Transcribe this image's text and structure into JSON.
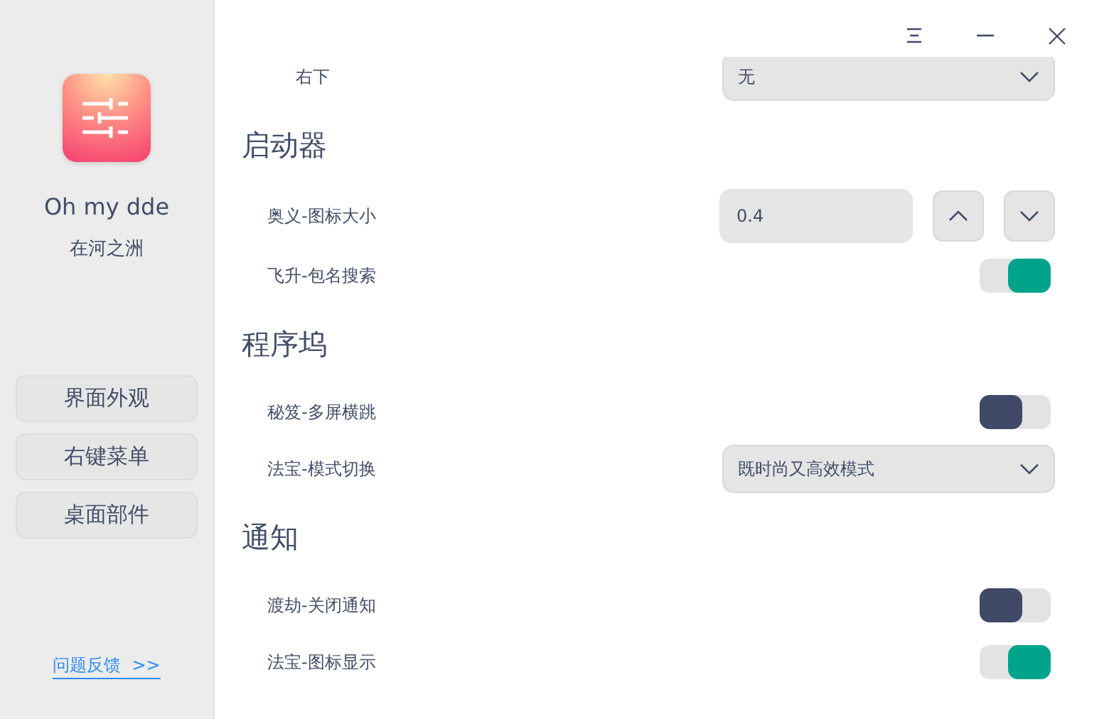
{
  "sidebar": {
    "app_name": "Oh my dde",
    "subtitle": "在河之洲",
    "items": [
      {
        "label": "界面外观"
      },
      {
        "label": "右键菜单"
      },
      {
        "label": "桌面部件"
      }
    ],
    "feedback_link": "问题反馈  >>"
  },
  "sections": [
    {
      "rows": [
        {
          "kind": "select",
          "label": "右下",
          "sub": true,
          "value": "无"
        }
      ]
    },
    {
      "title": "启动器",
      "rows": [
        {
          "kind": "spin",
          "label": "奥义-图标大小",
          "value": "0.4"
        },
        {
          "kind": "switch",
          "label": "飞升-包名搜索",
          "on": true
        }
      ]
    },
    {
      "title": "程序坞",
      "rows": [
        {
          "kind": "switch",
          "label": "秘笈-多屏横跳",
          "on": false
        },
        {
          "kind": "select",
          "label": "法宝-模式切换",
          "value": "既时尚又高效模式"
        }
      ]
    },
    {
      "title": "通知",
      "rows": [
        {
          "kind": "switch",
          "label": "渡劫-关闭通知",
          "on": false
        },
        {
          "kind": "switch",
          "label": "法宝-图标显示",
          "on": true
        }
      ]
    }
  ]
}
